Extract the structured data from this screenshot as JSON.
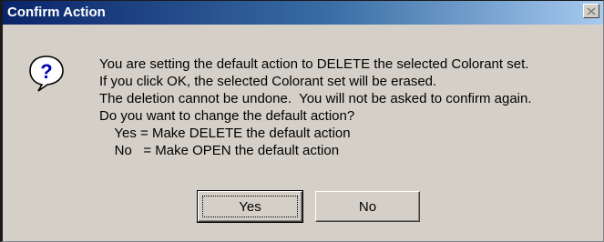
{
  "dialog": {
    "title": "Confirm Action",
    "icon": "question-icon",
    "message_lines": [
      "You are setting the default action to DELETE the selected Colorant set.",
      "If you click OK, the selected Colorant set will be erased.",
      "The deletion cannot be undone.  You will not be asked to confirm again.",
      "Do you want to change the default action?",
      "    Yes = Make DELETE the default action",
      "    No   = Make OPEN the default action"
    ],
    "buttons": {
      "yes_label": "Yes",
      "no_label": "No"
    }
  },
  "colors": {
    "titlebar_start": "#0a246a",
    "titlebar_end": "#a6caf0",
    "dialog_face": "#d4d0c8"
  }
}
